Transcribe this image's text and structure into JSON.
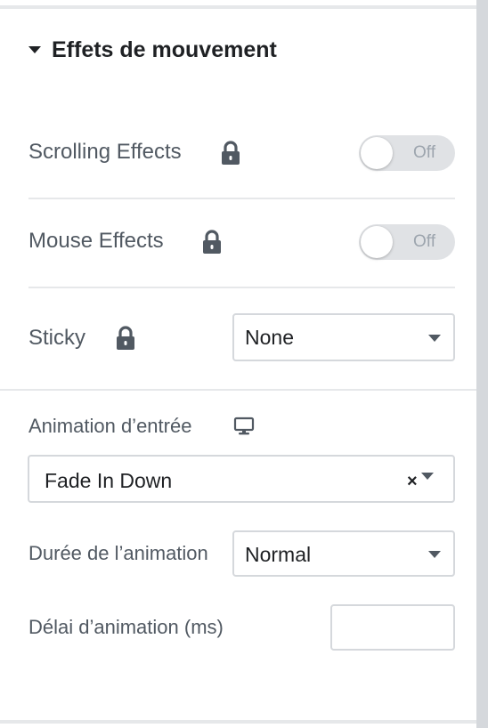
{
  "section": {
    "title": "Effets de mouvement"
  },
  "scrolling_effects": {
    "label": "Scrolling Effects",
    "toggle_text": "Off"
  },
  "mouse_effects": {
    "label": "Mouse Effects",
    "toggle_text": "Off"
  },
  "sticky": {
    "label": "Sticky",
    "value": "None"
  },
  "entrance_animation": {
    "label": "Animation d’entrée",
    "value": "Fade In Down",
    "clear_symbol": "×"
  },
  "animation_duration": {
    "label": "Durée de l’animation",
    "value": "Normal"
  },
  "animation_delay": {
    "label": "Délai d’animation (ms)",
    "value": ""
  },
  "icons": {
    "section_toggle": "caret-down-icon",
    "lock": "lock-icon",
    "responsive": "desktop-monitor-icon",
    "dropdown": "chevron-down-icon"
  },
  "colors": {
    "heading": "#1f2124",
    "label": "#515962",
    "toggle_track": "#e0e2e5",
    "divider": "#e6e8ea",
    "border": "#d5d8dc",
    "scrollbar": "#d5d8dc"
  }
}
